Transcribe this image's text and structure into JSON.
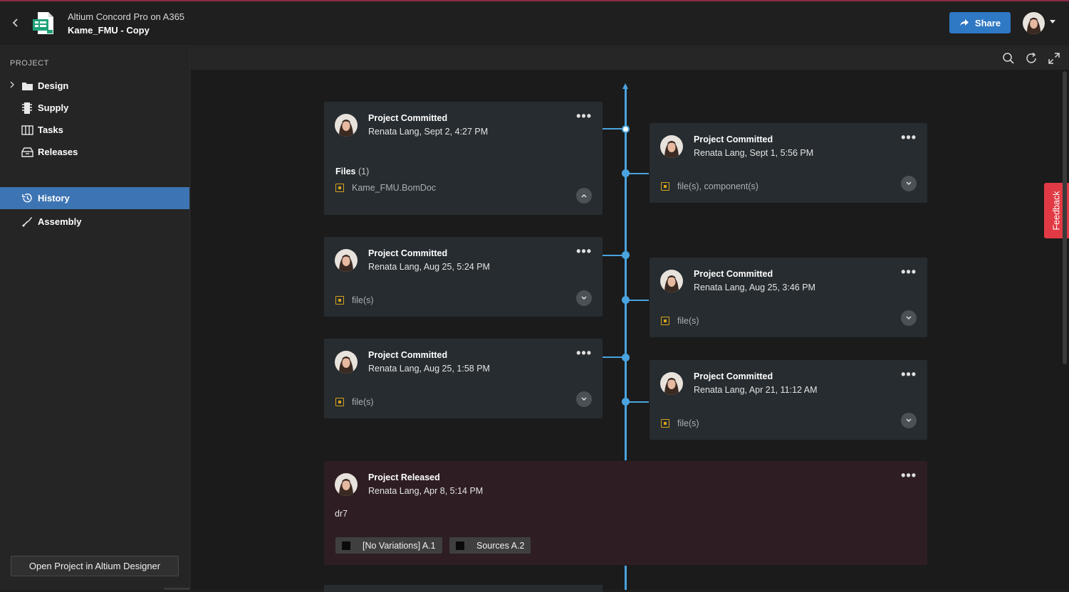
{
  "header": {
    "app_name": "Altium Concord Pro on A365",
    "project_name": "Kame_FMU - Copy",
    "share_label": "Share"
  },
  "sidebar": {
    "heading": "PROJECT",
    "items": [
      {
        "label": "Design",
        "icon": "folder-icon"
      },
      {
        "label": "Supply",
        "icon": "chip-icon"
      },
      {
        "label": "Tasks",
        "icon": "board-icon"
      },
      {
        "label": "Releases",
        "icon": "releases-icon"
      },
      {
        "label": "History",
        "icon": "history-icon",
        "active": true
      },
      {
        "label": "Assembly",
        "icon": "assembly-icon"
      }
    ],
    "open_button": "Open Project in Altium Designer"
  },
  "timeline": {
    "cards": [
      {
        "title": "Project Committed",
        "sub": "Renata Lang, Sept 2, 4:27 PM",
        "files_label": "Files",
        "files_count": "(1)",
        "file": "Kame_FMU.BomDoc"
      },
      {
        "title": "Project Committed",
        "sub": "Renata Lang, Sept 1, 5:56 PM",
        "file": "file(s), component(s)"
      },
      {
        "title": "Project Committed",
        "sub": "Renata Lang, Aug 25, 5:24 PM",
        "file": "file(s)"
      },
      {
        "title": "Project Committed",
        "sub": "Renata Lang, Aug 25, 3:46 PM",
        "file": "file(s)"
      },
      {
        "title": "Project Committed",
        "sub": "Renata Lang, Aug 25, 1:58 PM",
        "file": "file(s)"
      },
      {
        "title": "Project Committed",
        "sub": "Renata Lang, Apr 21, 11:12 AM",
        "file": "file(s)"
      }
    ],
    "release": {
      "title": "Project Released",
      "sub": "Renata Lang, Apr 8, 5:14 PM",
      "desc": "dr7",
      "chips": [
        "[No Variations] A.1",
        "Sources A.2"
      ]
    }
  },
  "feedback_label": "Feedback",
  "colors": {
    "accent": "#2f78c4",
    "timeline": "#4aa3df",
    "feedback": "#e23a44",
    "file_icon": "#d9a21b",
    "release_bg": "#2e1e23"
  }
}
